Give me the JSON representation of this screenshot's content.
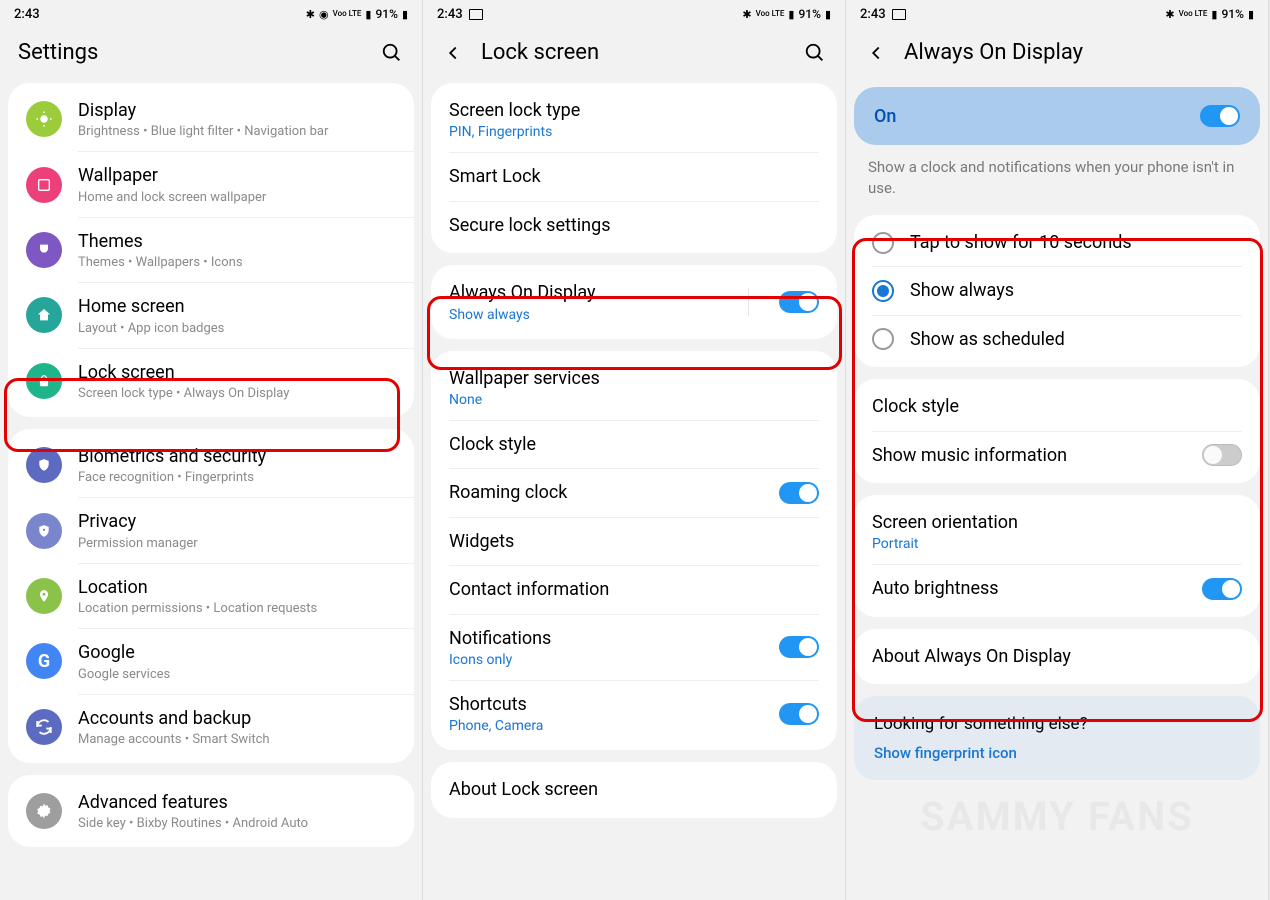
{
  "status": {
    "time": "2:43",
    "indicators": "Voo LTE",
    "battery": "91%"
  },
  "phone1": {
    "title": "Settings",
    "items": [
      {
        "icon": "display",
        "color": "#9ccc3c",
        "title": "Display",
        "sub": "Brightness  •  Blue light filter  •  Navigation bar"
      },
      {
        "icon": "wallpaper",
        "color": "#ec407a",
        "title": "Wallpaper",
        "sub": "Home and lock screen wallpaper"
      },
      {
        "icon": "themes",
        "color": "#7e57c2",
        "title": "Themes",
        "sub": "Themes  •  Wallpapers  •  Icons"
      },
      {
        "icon": "home",
        "color": "#26a69a",
        "title": "Home screen",
        "sub": "Layout  •  App icon badges"
      },
      {
        "icon": "lock",
        "color": "#1db589",
        "title": "Lock screen",
        "sub": "Screen lock type  •  Always On Display"
      },
      {
        "icon": "shield",
        "color": "#5c6bc0",
        "title": "Biometrics and security",
        "sub": "Face recognition  •  Fingerprints"
      },
      {
        "icon": "privacy",
        "color": "#7986cb",
        "title": "Privacy",
        "sub": "Permission manager"
      },
      {
        "icon": "location",
        "color": "#8bc34a",
        "title": "Location",
        "sub": "Location permissions  •  Location requests"
      },
      {
        "icon": "google",
        "color": "#4285f4",
        "title": "Google",
        "sub": "Google services"
      },
      {
        "icon": "accounts",
        "color": "#5c6bc0",
        "title": "Accounts and backup",
        "sub": "Manage accounts  •  Smart Switch"
      },
      {
        "icon": "advanced",
        "color": "#9e9e9e",
        "title": "Advanced features",
        "sub": "Side key  •  Bixby Routines  •  Android Auto"
      }
    ]
  },
  "phone2": {
    "title": "Lock screen",
    "group1": [
      {
        "title": "Screen lock type",
        "subBlue": "PIN, Fingerprints"
      },
      {
        "title": "Smart Lock"
      },
      {
        "title": "Secure lock settings"
      }
    ],
    "aod": {
      "title": "Always On Display",
      "subBlue": "Show always",
      "toggle": true
    },
    "group2": [
      {
        "title": "Wallpaper services",
        "subBlue": "None"
      },
      {
        "title": "Clock style"
      },
      {
        "title": "Roaming clock",
        "toggle": true
      },
      {
        "title": "Widgets"
      },
      {
        "title": "Contact information"
      },
      {
        "title": "Notifications",
        "subBlue": "Icons only",
        "toggle": true
      },
      {
        "title": "Shortcuts",
        "subBlue": "Phone, Camera",
        "toggle": true
      }
    ],
    "about": "About Lock screen"
  },
  "phone3": {
    "title": "Always On Display",
    "onLabel": "On",
    "description": "Show a clock and notifications when your phone isn't in use.",
    "radios": [
      {
        "label": "Tap to show for 10 seconds",
        "checked": false
      },
      {
        "label": "Show always",
        "checked": true
      },
      {
        "label": "Show as scheduled",
        "checked": false
      }
    ],
    "clockStyle": "Clock style",
    "musicInfo": {
      "title": "Show music information",
      "toggle": false
    },
    "orientation": {
      "title": "Screen orientation",
      "subBlue": "Portrait"
    },
    "autoBright": {
      "title": "Auto brightness",
      "toggle": true
    },
    "about": "About Always On Display",
    "looking": {
      "title": "Looking for something else?",
      "link": "Show fingerprint icon"
    }
  },
  "watermark": "SAMMY FANS"
}
